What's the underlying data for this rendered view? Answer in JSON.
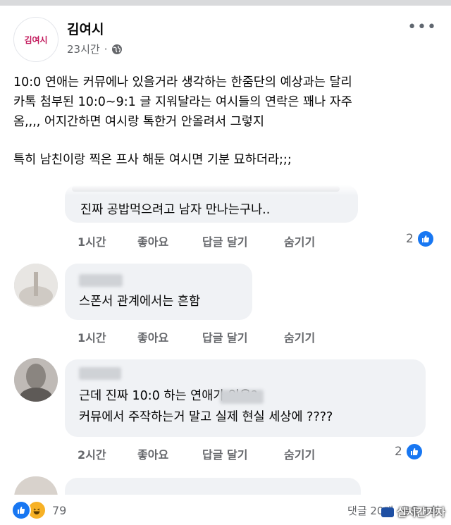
{
  "colors": {
    "accent": "#1877f2",
    "muted": "#65676b",
    "bubble": "#f0f2f5"
  },
  "post": {
    "page_logo_text": "김여시",
    "author": "김여시",
    "time": "23시간",
    "paragraph1": "10:0 연애는 커뮤에나 있을거라 생각하는 한줌단의 예상과는 달리\n카톡 첨부된 10:0~9:1 글 지워달라는 여시들의 연락은 꽤나 자주\n옴,,,, 어지간하면 여시랑 톡한거 안올려서 그렇지",
    "paragraph2": "특히 남친이랑 찍은 프사 해둔 여시면 기분 묘하더라;;;"
  },
  "comments": [
    {
      "text": "진짜 공밥먹으려고 남자 만나는구나..",
      "time": "1시간",
      "like": "좋아요",
      "reply": "답글 달기",
      "hide": "숨기기",
      "reactions": "2"
    },
    {
      "name_visible": "",
      "text": "스폰서 관계에서는 흔함",
      "time": "1시간",
      "like": "좋아요",
      "reply": "답글 달기",
      "hide": "숨기기"
    },
    {
      "text": "근데 진짜 10:0 하는      연애가 있음?\n커뮤에서 주작하는거 말고 실제 현실 세상에 ????",
      "time": "2시간",
      "like": "좋아요",
      "reply": "답글 달기",
      "hide": "숨기기",
      "reactions": "2"
    }
  ],
  "footer": {
    "reaction_count": "79",
    "comments": "댓글 20개",
    "shares": "공유 1회",
    "watermark": "실시간기자"
  }
}
